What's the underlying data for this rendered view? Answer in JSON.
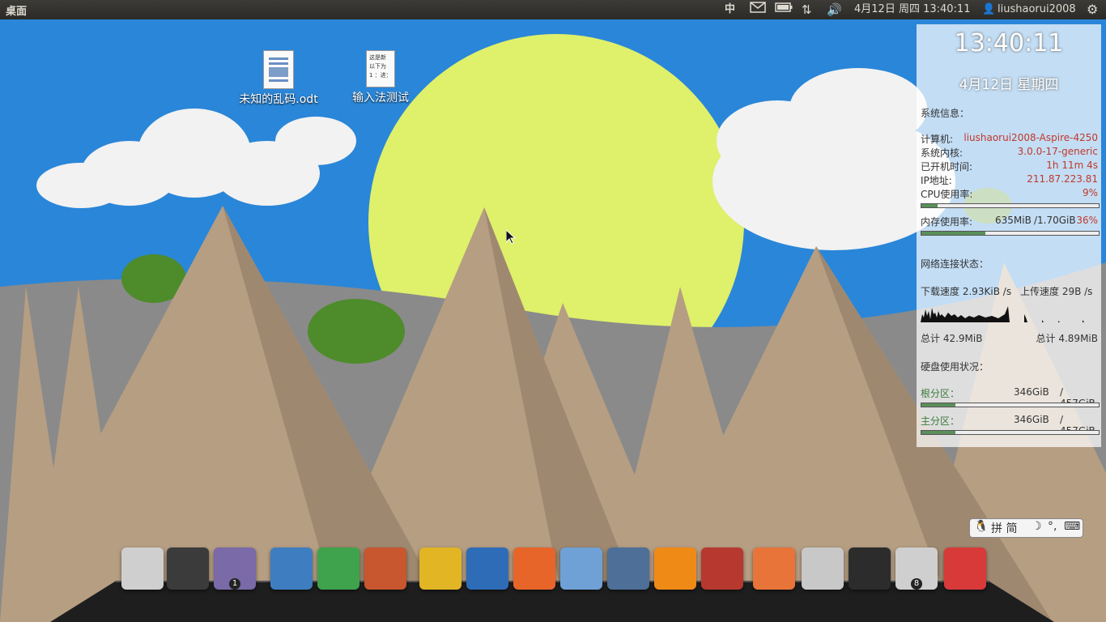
{
  "topbar": {
    "desktop_label": "桌面",
    "datetime": "4月12日 周四 13:40:11",
    "user": "liushaorui2008",
    "ime_icon": "中"
  },
  "desktop_icons": [
    {
      "label": "未知的乱码.odt",
      "icon": "odt-document-icon"
    },
    {
      "label": "输入法测试",
      "icon": "text-document-icon",
      "preview": "这是新\n以下为\n1 ：进："
    }
  ],
  "conky": {
    "clock": "13:40:11",
    "date": "4月12日 星期四",
    "sys_title": "系统信息：",
    "rows": [
      {
        "k": "计算机:",
        "v": "liushaorui2008-Aspire-4250"
      },
      {
        "k": "系统内核:",
        "v": "3.0.0-17-generic"
      },
      {
        "k": "已开机时间:",
        "v": "1h 11m 4s"
      },
      {
        "k": "IP地址:",
        "v": "211.87.223.81"
      },
      {
        "k": "CPU使用率:",
        "v": "9%"
      }
    ],
    "cpu_fraction": 0.09,
    "mem_label": "内存使用率:",
    "mem_used": "635MiB",
    "mem_total": "/1.70GiB",
    "mem_pct": "36%",
    "mem_fraction": 0.36,
    "net_title": "网络连接状态：",
    "down_label": "下载速度 2.93KiB  /s",
    "up_label": "上传速度 29B    /s",
    "down_total": "总计 42.9MiB",
    "up_total": "总计 4.89MiB",
    "disk_title": "硬盘使用状况：",
    "disks": [
      {
        "name": "根分区：",
        "used": "346GiB",
        "total": "/ 457GiB",
        "fraction": 0.19
      },
      {
        "name": "主分区：",
        "used": "346GiB",
        "total": "/ 457GiB",
        "fraction": 0.19
      }
    ]
  },
  "ime_bar": {
    "label": "拼 简"
  },
  "dock": {
    "items": [
      {
        "name": "ubuntu-logo-icon",
        "color": "#cfcfcf"
      },
      {
        "name": "terminal-icon",
        "color": "#3b3b3b"
      },
      {
        "name": "workspace-switcher-icon",
        "color": "#7a6aa8",
        "badge": "1"
      },
      {
        "name": "libreoffice-writer-icon",
        "color": "#3e7ec0"
      },
      {
        "name": "libreoffice-calc-icon",
        "color": "#3fa34d"
      },
      {
        "name": "libreoffice-impress-icon",
        "color": "#c8562f"
      },
      {
        "name": "chrome-icon",
        "color": "#e2b524"
      },
      {
        "name": "thunderbird-icon",
        "color": "#2f6cb8"
      },
      {
        "name": "software-center-icon",
        "color": "#e8652a"
      },
      {
        "name": "blender-like-icon",
        "color": "#6fa1d6"
      },
      {
        "name": "image-viewer-icon",
        "color": "#4d6f98"
      },
      {
        "name": "download-manager-icon",
        "color": "#f08a16"
      },
      {
        "name": "joystick-icon",
        "color": "#b7382f"
      },
      {
        "name": "home-folder-icon",
        "color": "#e8743a"
      },
      {
        "name": "settings-icon",
        "color": "#c8c8c8"
      },
      {
        "name": "system-monitor-icon",
        "color": "#2c2c2c"
      },
      {
        "name": "trash-icon",
        "color": "#cfcfcf",
        "badge": "8"
      },
      {
        "name": "power-icon",
        "color": "#d83a3a"
      }
    ]
  }
}
